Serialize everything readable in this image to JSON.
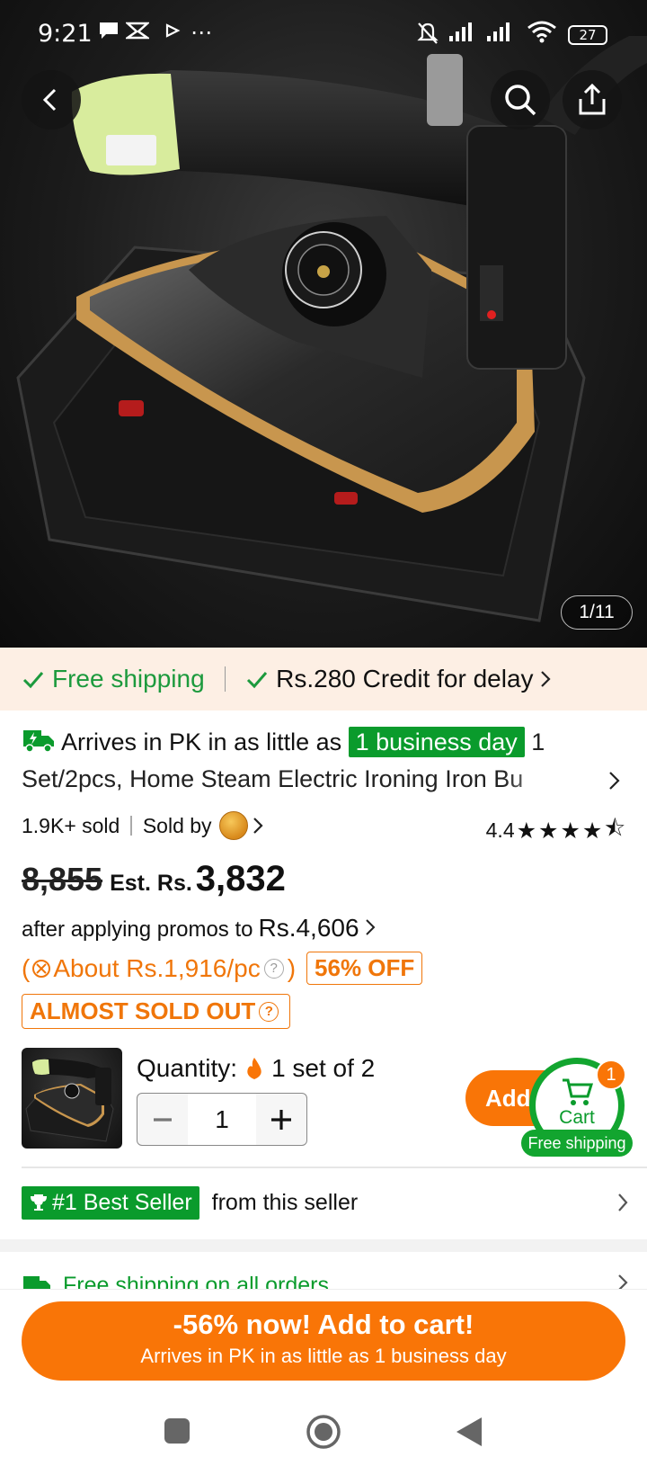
{
  "status_bar": {
    "time": "9:21",
    "extra_icons": "⋯",
    "battery": "27"
  },
  "header": {
    "back_icon": "back-arrow-icon",
    "search_icon": "search-icon",
    "share_icon": "share-icon"
  },
  "gallery": {
    "counter": "1/11"
  },
  "shipping_strip": {
    "free_shipping": "Free shipping",
    "credit": "Rs.280 Credit for delay"
  },
  "product": {
    "arrives_prefix": "Arrives in PK in as little as",
    "arrives_highlight": "1 business day",
    "title": "1 Set/2pcs, Home Steam Electric Ironing Iron Bu",
    "sold": "1.9K+ sold",
    "sold_by": "Sold by",
    "rating": "4.4"
  },
  "price": {
    "original": "8,855",
    "est_label": "Est. Rs.",
    "current": "3,832",
    "after_promo_label": "after applying promos to",
    "after_promo_value": "Rs.4,606",
    "per_piece": "About Rs.1,916/pc",
    "discount": "56% OFF",
    "stock_alert": "ALMOST SOLD OUT"
  },
  "quantity": {
    "label": "Quantity:",
    "set_info": "1 set of 2",
    "value": "1",
    "minus": "−",
    "plus": "+"
  },
  "cart": {
    "add_label": "Add",
    "label": "Cart",
    "badge": "1",
    "free_shipping": "Free shipping"
  },
  "best_seller": {
    "badge": "#1 Best Seller",
    "text": "from this seller"
  },
  "free_all": {
    "text": "Free shipping on all orders"
  },
  "cta": {
    "line1": "-56% now! Add to cart!",
    "line2": "Arrives in PK in as little as 1 business day"
  },
  "colors": {
    "accent_orange": "#f97507",
    "green": "#0a9b2c",
    "strip_bg": "#fdefe4"
  }
}
